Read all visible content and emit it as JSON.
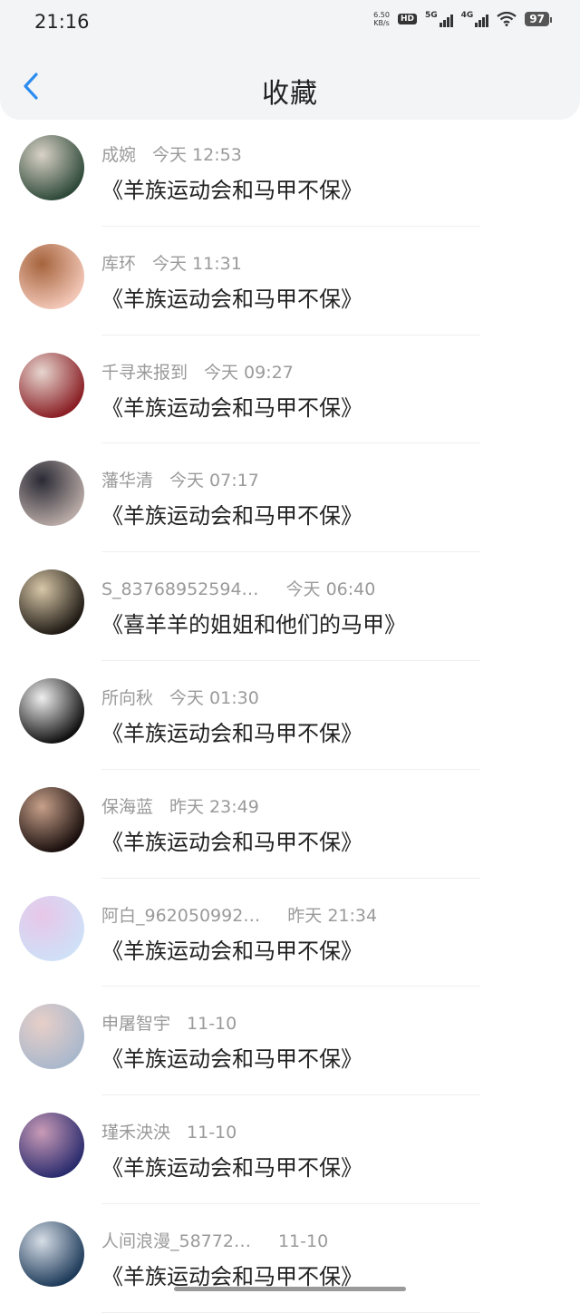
{
  "status_bar": {
    "time": "21:16",
    "net_speed_value": "6.50",
    "net_speed_unit": "KB/s",
    "hd_label": "HD",
    "sim1_label": "5G",
    "sim2_label": "4G",
    "battery": "97"
  },
  "header": {
    "title": "收藏",
    "back_icon": "chevron-left-icon"
  },
  "colors": {
    "accent": "#2b8cf0",
    "meta_text": "#9a9a9a",
    "header_bg": "#f3f4f6"
  },
  "items": [
    {
      "name": "成婉",
      "time": "今天 12:53",
      "work": "《羊族运动会和马甲不保》",
      "avatar": [
        "#2f4a3a",
        "#d9d2c7"
      ]
    },
    {
      "name": "库环",
      "time": "今天 11:31",
      "work": "《羊族运动会和马甲不保》",
      "avatar": [
        "#f2c6b6",
        "#a5643d"
      ]
    },
    {
      "name": "千寻来报到",
      "time": "今天 09:27",
      "work": "《羊族运动会和马甲不保》",
      "avatar": [
        "#8a1f25",
        "#e7d6cf"
      ]
    },
    {
      "name": "藩华清",
      "time": "今天 07:17",
      "work": "《羊族运动会和马甲不保》",
      "avatar": [
        "#b7a9a5",
        "#2a2a35"
      ]
    },
    {
      "name": "S_83768952594…",
      "time": "今天 06:40",
      "work": "《喜羊羊的姐姐和他们的马甲》",
      "avatar": [
        "#1f1a14",
        "#d8c7a8"
      ]
    },
    {
      "name": "所向秋",
      "time": "今天 01:30",
      "work": "《羊族运动会和马甲不保》",
      "avatar": [
        "#111111",
        "#efefef"
      ]
    },
    {
      "name": "保海蓝",
      "time": "昨天 23:49",
      "work": "《羊族运动会和马甲不保》",
      "avatar": [
        "#1a0f0d",
        "#c7a08a"
      ]
    },
    {
      "name": "阿白_962050992…",
      "time": "昨天 21:34",
      "work": "《羊族运动会和马甲不保》",
      "avatar": [
        "#cfe0f7",
        "#e8c6e8"
      ]
    },
    {
      "name": "申屠智宇",
      "time": "11-10",
      "work": "《羊族运动会和马甲不保》",
      "avatar": [
        "#aab8cc",
        "#e7cfc8"
      ]
    },
    {
      "name": "瑾禾泱泱",
      "time": "11-10",
      "work": "《羊族运动会和马甲不保》",
      "avatar": [
        "#2b2c6e",
        "#c99bb7"
      ]
    },
    {
      "name": "人间浪漫_58772…",
      "time": "11-10",
      "work": "《羊族运动会和马甲不保》",
      "avatar": [
        "#1e3b5a",
        "#d6dde6"
      ]
    }
  ]
}
